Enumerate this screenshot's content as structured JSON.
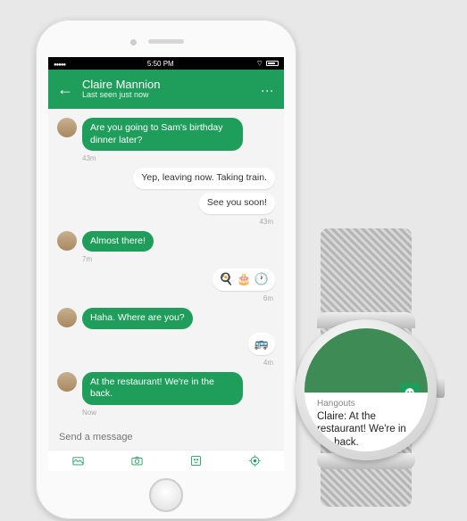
{
  "phone": {
    "statusbar": {
      "time": "5:50 PM"
    },
    "header": {
      "contact_name": "Claire Mannion",
      "subtitle": "Last seen just now"
    },
    "messages": [
      {
        "dir": "in",
        "avatar": true,
        "text": "Are you going to Sam's birthday dinner later?",
        "ts": "43m"
      },
      {
        "dir": "out",
        "text": "Yep, leaving now. Taking train."
      },
      {
        "dir": "out",
        "text": "See you soon!",
        "ts": "43m"
      },
      {
        "dir": "in",
        "avatar": true,
        "text": "Almost there!",
        "ts": "7m"
      },
      {
        "dir": "out",
        "icons": "🍳 🎂 🕐",
        "ts": "6m"
      },
      {
        "dir": "in",
        "avatar": true,
        "text": "Haha. Where are you?"
      },
      {
        "dir": "out",
        "icons": "🚌",
        "ts": "4m"
      },
      {
        "dir": "in",
        "avatar": true,
        "text": "At the restaurant! We're in the back.",
        "ts": "Now"
      }
    ],
    "composer": {
      "placeholder": "Send a message"
    },
    "toolbar": {
      "items": [
        "gallery-icon",
        "camera-icon",
        "sticker-icon",
        "location-icon"
      ]
    }
  },
  "watch": {
    "app_name": "Hangouts",
    "notification_text": "Claire: At the restaurant! We're in the back.",
    "app_icon": "hangouts-icon",
    "accent": "#3f8b55"
  },
  "colors": {
    "primary": "#1e9e5a"
  }
}
